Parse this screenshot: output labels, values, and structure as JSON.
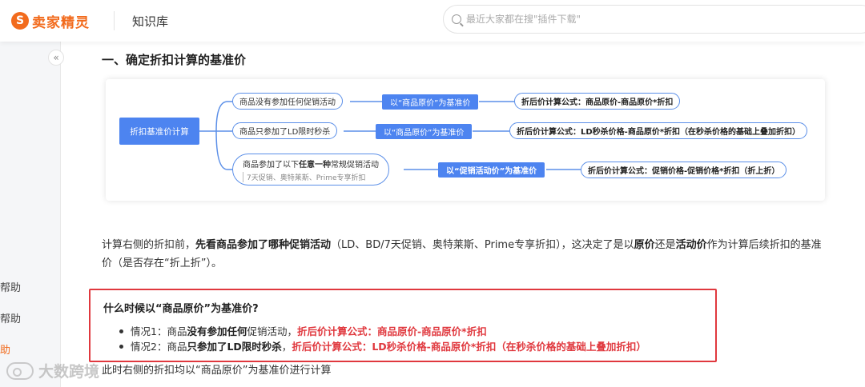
{
  "header": {
    "logo_mark": "S",
    "logo_text": "卖家精灵",
    "title": "知识库",
    "search_placeholder": "最近大家都在搜\"插件下载\""
  },
  "sidebar": {
    "collapse": "«",
    "items": [
      {
        "label": "帮助",
        "active": false
      },
      {
        "label": "帮助",
        "active": false
      },
      {
        "label": "助",
        "active": true
      }
    ]
  },
  "section": {
    "title": "一、确定折扣计算的基准价"
  },
  "diagram": {
    "root": "折扣基准价计算",
    "branches": [
      {
        "condition": "商品没有参加任何促销活动",
        "base": "以“商品原价”为基准价",
        "formula": "折后价计算公式：商品原价-商品原价*折扣"
      },
      {
        "condition": "商品只参加了LD限时秒杀",
        "base": "以“商品原价”为基准价",
        "formula": "折后价计算公式：LD秒杀价格-商品原价*折扣（在秒杀价格的基础上叠加折扣）"
      },
      {
        "condition_pre": "商品参加了以下",
        "condition_bold": "任意一种",
        "condition_post": "常规促销活动",
        "condition_sub": "7天促销、奥特莱斯、Prime专享折扣",
        "base": "以“促销活动价”为基准价",
        "formula": "折后价计算公式：促销价格-促销价格*折扣（折上折）"
      }
    ]
  },
  "paragraph": {
    "p1": "计算右侧的折扣前，",
    "b1": "先看商品参加了哪种促销活动",
    "p2": "（LD、BD/7天促销、奥特莱斯、Prime专享折扣），这决定了是以",
    "b2": "原价",
    "p3": "还是",
    "b3": "活动价",
    "p4": "作为计算后续折扣的基准价（是否存在“折上折”）。"
  },
  "callout": {
    "title": "什么时候以“商品原价”为基准价?",
    "case1_prefix": "情况1：商品",
    "case1_bold": "没有参加任何",
    "case1_mid": "促销活动，",
    "case1_red": "折后价计算公式：商品原价-商品原价*折扣",
    "case2_prefix": "情况2：商品",
    "case2_bold": "只参加了LD限时秒杀",
    "case2_mid": "，",
    "case2_red": "折后价计算公式：LD秒杀价格-商品原价*折扣（在秒杀价格的基础上叠加折扣）"
  },
  "bottom_line": "此时右侧的折扣均以“商品原价”为基准价进行计算",
  "watermark": "大数跨境",
  "colors": {
    "brand": "#f26b1d",
    "diagram_blue": "#4d84f0",
    "alert_red": "#e0383e"
  }
}
